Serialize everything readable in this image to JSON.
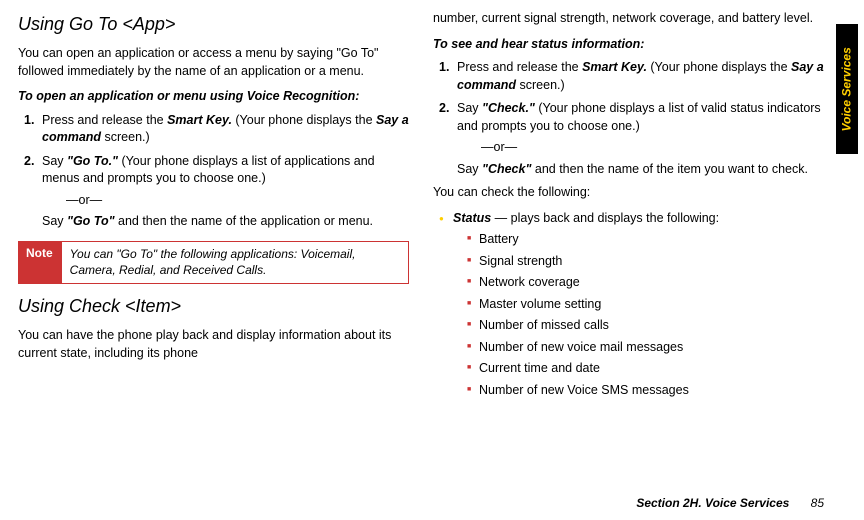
{
  "tab": "Voice Services",
  "col1": {
    "h1": "Using Go To <App>",
    "p1": "You can open an application or access a menu by saying \"Go To\" followed immediately by the name of an application or a menu.",
    "sub1": "To open an application or menu using Voice Recognition:",
    "step1a": "Press and release the ",
    "step1b": "Smart Key.",
    "step1c": " (Your phone displays the ",
    "step1d": "Say a command",
    "step1e": " screen.)",
    "step2a": "Say ",
    "step2b": "\"Go To.\"",
    "step2c": " (Your phone displays a list of applications and menus and prompts you to choose one.)",
    "or": "—or—",
    "step2d": "Say ",
    "step2e": "\"Go To\"",
    "step2f": " and then the name of the application or menu.",
    "noteLabel": "Note",
    "noteBody": "You can \"Go To\" the following applications: Voicemail, Camera, Redial, and Received Calls.",
    "h2": "Using Check <Item>",
    "p2": "You can have the phone play back and display information about its current state, including its phone"
  },
  "col2": {
    "p1": "number, current signal strength, network coverage, and battery level.",
    "sub1": "To see and hear status information:",
    "step1a": "Press and release the ",
    "step1b": "Smart Key.",
    "step1c": " (Your phone displays the ",
    "step1d": "Say a command",
    "step1e": " screen.)",
    "step2a": "Say ",
    "step2b": "\"Check.\"",
    "step2c": " (Your phone displays a list of valid status indicators and prompts you to choose one.)",
    "or": "—or—",
    "step2d": "Say ",
    "step2e": "\"Check\"",
    "step2f": " and then the name of the item you want to check.",
    "p2": "You can check the following:",
    "statusLabel": "Status",
    "statusText": " — plays back and displays the following:",
    "items": [
      "Battery",
      "Signal strength",
      "Network coverage",
      "Master volume setting",
      "Number of missed calls",
      "Number of new voice mail messages",
      "Current time and date",
      "Number of new Voice SMS messages"
    ]
  },
  "footer": {
    "section": "Section 2H. Voice Services",
    "page": "85"
  }
}
